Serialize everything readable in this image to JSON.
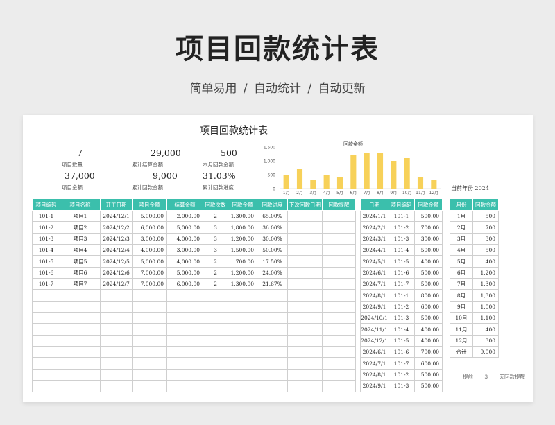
{
  "header": {
    "title": "项目回款统计表",
    "subtitle": "简单易用 / 自动统计 / 自动更新"
  },
  "sheet": {
    "title": "项目回款统计表",
    "kpis": {
      "project_count": {
        "value": "7",
        "label": "项目数量"
      },
      "settled_total": {
        "value": "29,000",
        "label": "累计结算金额"
      },
      "month_payment": {
        "value": "500",
        "label": "本月回款金额"
      },
      "project_amount": {
        "value": "37,000",
        "label": "项目金额"
      },
      "payment_total": {
        "value": "9,000",
        "label": "累计回款金额"
      },
      "payment_progress": {
        "value": "31.03%",
        "label": "累计回款进度"
      }
    },
    "current_month_label": "当前年份 2024",
    "remind_note": "提前 3 天回款提醒"
  },
  "chart_data": {
    "type": "bar",
    "title": "回款金额",
    "categories": [
      "1月",
      "2月",
      "3月",
      "4月",
      "5月",
      "6月",
      "7月",
      "8月",
      "9月",
      "10月",
      "11月",
      "12月"
    ],
    "values": [
      500,
      700,
      300,
      500,
      400,
      1200,
      1300,
      1300,
      1000,
      1100,
      400,
      300
    ],
    "ylim": [
      0,
      1500
    ],
    "yticks": [
      "0",
      "500",
      "1,000",
      "1,500"
    ],
    "bar_color": "#f7d159"
  },
  "main_table": {
    "headers": [
      "项目编码",
      "项目名称",
      "开工日期",
      "项目金额",
      "结算金额",
      "回款次数",
      "回款金额",
      "回款进度",
      "下次回款日期",
      "回款提醒"
    ],
    "rows": [
      [
        "101-1",
        "项目1",
        "2024/12/1",
        "5,000.00",
        "2,000.00",
        "2",
        "1,300.00",
        "65.00%",
        "",
        ""
      ],
      [
        "101-2",
        "项目2",
        "2024/12/2",
        "6,000.00",
        "5,000.00",
        "3",
        "1,800.00",
        "36.00%",
        "",
        ""
      ],
      [
        "101-3",
        "项目3",
        "2024/12/3",
        "3,000.00",
        "4,000.00",
        "3",
        "1,200.00",
        "30.00%",
        "",
        ""
      ],
      [
        "101-4",
        "项目4",
        "2024/12/4",
        "4,000.00",
        "3,000.00",
        "3",
        "1,500.00",
        "50.00%",
        "",
        ""
      ],
      [
        "101-5",
        "项目5",
        "2024/12/5",
        "5,000.00",
        "4,000.00",
        "2",
        "700.00",
        "17.50%",
        "",
        ""
      ],
      [
        "101-6",
        "项目6",
        "2024/12/6",
        "7,000.00",
        "5,000.00",
        "2",
        "1,200.00",
        "24.00%",
        "",
        ""
      ],
      [
        "101-7",
        "项目7",
        "2024/12/7",
        "7,000.00",
        "6,000.00",
        "2",
        "1,300.00",
        "21.67%",
        "",
        ""
      ]
    ],
    "empty_rows": 9
  },
  "payment_table": {
    "headers": [
      "日期",
      "项目编码",
      "回款金额"
    ],
    "rows": [
      [
        "2024/1/1",
        "101-1",
        "500.00"
      ],
      [
        "2024/2/1",
        "101-2",
        "700.00"
      ],
      [
        "2024/3/1",
        "101-3",
        "300.00"
      ],
      [
        "2024/4/1",
        "101-4",
        "500.00"
      ],
      [
        "2024/5/1",
        "101-5",
        "400.00"
      ],
      [
        "2024/6/1",
        "101-6",
        "500.00"
      ],
      [
        "2024/7/1",
        "101-7",
        "500.00"
      ],
      [
        "2024/8/1",
        "101-1",
        "800.00"
      ],
      [
        "2024/9/1",
        "101-2",
        "600.00"
      ],
      [
        "2024/10/1",
        "101-3",
        "500.00"
      ],
      [
        "2024/11/1",
        "101-4",
        "400.00"
      ],
      [
        "2024/12/1",
        "101-5",
        "400.00"
      ],
      [
        "2024/6/1",
        "101-6",
        "700.00"
      ],
      [
        "2024/7/1",
        "101-7",
        "600.00"
      ],
      [
        "2024/8/1",
        "101-2",
        "500.00"
      ],
      [
        "2024/9/1",
        "101-3",
        "500.00"
      ]
    ]
  },
  "month_table": {
    "headers": [
      "月份",
      "回款金额"
    ],
    "rows": [
      [
        "1月",
        "500"
      ],
      [
        "2月",
        "700"
      ],
      [
        "3月",
        "300"
      ],
      [
        "4月",
        "500"
      ],
      [
        "5月",
        "400"
      ],
      [
        "6月",
        "1,200"
      ],
      [
        "7月",
        "1,300"
      ],
      [
        "8月",
        "1,300"
      ],
      [
        "9月",
        "1,000"
      ],
      [
        "10月",
        "1,100"
      ],
      [
        "11月",
        "400"
      ],
      [
        "12月",
        "300"
      ],
      [
        "合计",
        "9,000"
      ]
    ]
  },
  "colors": {
    "header_teal": "#3bbfac",
    "bar_yellow": "#f7d159"
  }
}
